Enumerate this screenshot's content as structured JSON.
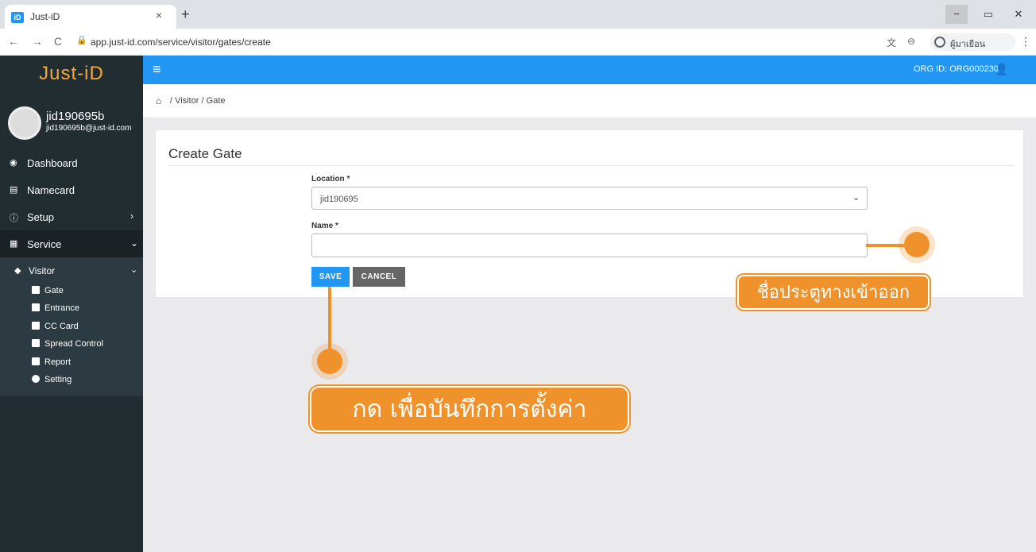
{
  "browser": {
    "tab_title": "Just-iD",
    "tab_favicon": "iD",
    "tab_close": "×",
    "new_tab": "+",
    "url": "app.just-id.com/service/visitor/gates/create",
    "profile_name": "ผู้มาเยือน",
    "window_min": "−",
    "window_max": "▭",
    "window_close": "✕",
    "back": "←",
    "forward": "→",
    "reload": "C",
    "translate": "文",
    "zoom": "⊖",
    "menu": "⋮",
    "lock": "🔒"
  },
  "sidebar": {
    "brand": "Just-iD",
    "user_name": "jid190695b",
    "user_email": "jid190695b@just-id.com",
    "menu": [
      {
        "label": "Dashboard",
        "icon": "dashboard-icon",
        "glyph": "◉"
      },
      {
        "label": "Namecard",
        "icon": "namecard-icon",
        "glyph": "▤"
      },
      {
        "label": "Setup",
        "icon": "info-icon",
        "glyph": "ⓘ",
        "caret": "›"
      },
      {
        "label": "Service",
        "icon": "service-icon",
        "glyph": "▦",
        "caret": "⌄"
      }
    ],
    "visitor": {
      "label": "Visitor",
      "glyph": "◆",
      "caret": "⌄"
    },
    "sub_items": [
      {
        "label": "Gate",
        "icon": "gate-icon"
      },
      {
        "label": "Entrance",
        "icon": "entrance-icon"
      },
      {
        "label": "CC Card",
        "icon": "cc-card-icon"
      },
      {
        "label": "Spread Control",
        "icon": "spread-control-icon"
      },
      {
        "label": "Report",
        "icon": "report-icon"
      },
      {
        "label": "Setting",
        "icon": "setting-icon"
      }
    ]
  },
  "topnav": {
    "hamburger": "≡",
    "org_id": "ORG ID: ORG000230",
    "user_glyph": "👤"
  },
  "breadcrumb": {
    "home_glyph": "⌂",
    "text": "/ Visitor / Gate"
  },
  "form": {
    "title": "Create Gate",
    "location_label": "Location *",
    "location_value": "jid190695",
    "select_caret": "⌄",
    "name_label": "Name *",
    "name_value": "",
    "save_label": "SAVE",
    "cancel_label": "CANCEL"
  },
  "annotations": {
    "name_callout": "ชื่อประตูทางเข้าออก",
    "save_callout": "กด เพื่อบันทึกการตั้งค่า",
    "color": "#f0922b"
  },
  "colors": {
    "primary": "#2196f3",
    "sidebar_bg": "#222d32",
    "brand": "#f5a93a"
  }
}
